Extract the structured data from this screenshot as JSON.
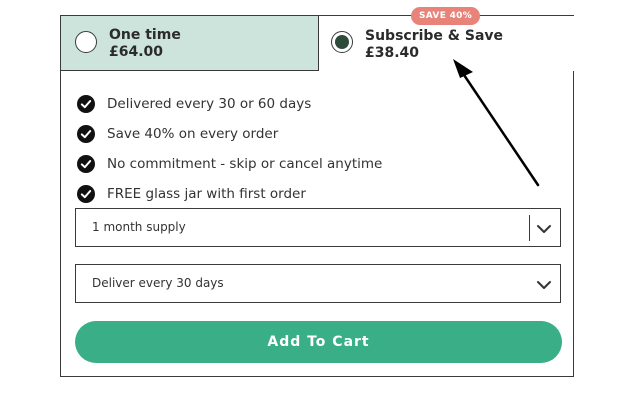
{
  "options": {
    "one_time": {
      "title": "One time",
      "price": "£64.00",
      "selected": false
    },
    "subscribe": {
      "title": "Subscribe & Save",
      "price": "£38.40",
      "selected": true,
      "badge": "SAVE 40%"
    }
  },
  "benefits": [
    {
      "text": "Delivered every 30 or 60 days"
    },
    {
      "text": "Save 40% on every order"
    },
    {
      "text": "No commitment - skip or cancel anytime"
    },
    {
      "text": "FREE glass jar with first order"
    }
  ],
  "supply_select": {
    "value": "1 month supply"
  },
  "delivery_select": {
    "value": "Deliver every 30 days"
  },
  "cart_button": {
    "label": "Add To Cart"
  },
  "colors": {
    "one_time_bg": "#cde4dc",
    "badge_bg": "#e8837a",
    "cart_button_bg": "#3aaf87",
    "selected_radio": "#2e4a3b"
  },
  "icons": {
    "check": "check-circle-icon",
    "chevron": "chevron-down-icon",
    "annotation": "arrow-icon"
  }
}
